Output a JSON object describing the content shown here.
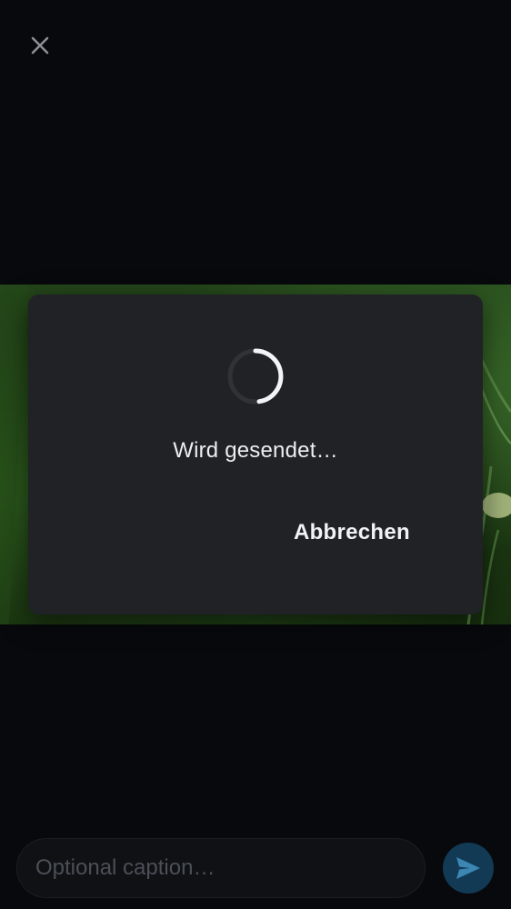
{
  "header": {
    "close_icon": "close-icon"
  },
  "dialog": {
    "spinner_icon": "loading-spinner-icon",
    "status_text": "Wird gesendet…",
    "cancel_label": "Abbrechen"
  },
  "composer": {
    "caption_placeholder": "Optional caption…",
    "caption_value": "",
    "send_icon": "send-icon"
  },
  "colors": {
    "background": "#07090c",
    "dialog": "#202226",
    "send_button": "#123a55",
    "send_icon": "#3c86b3"
  }
}
